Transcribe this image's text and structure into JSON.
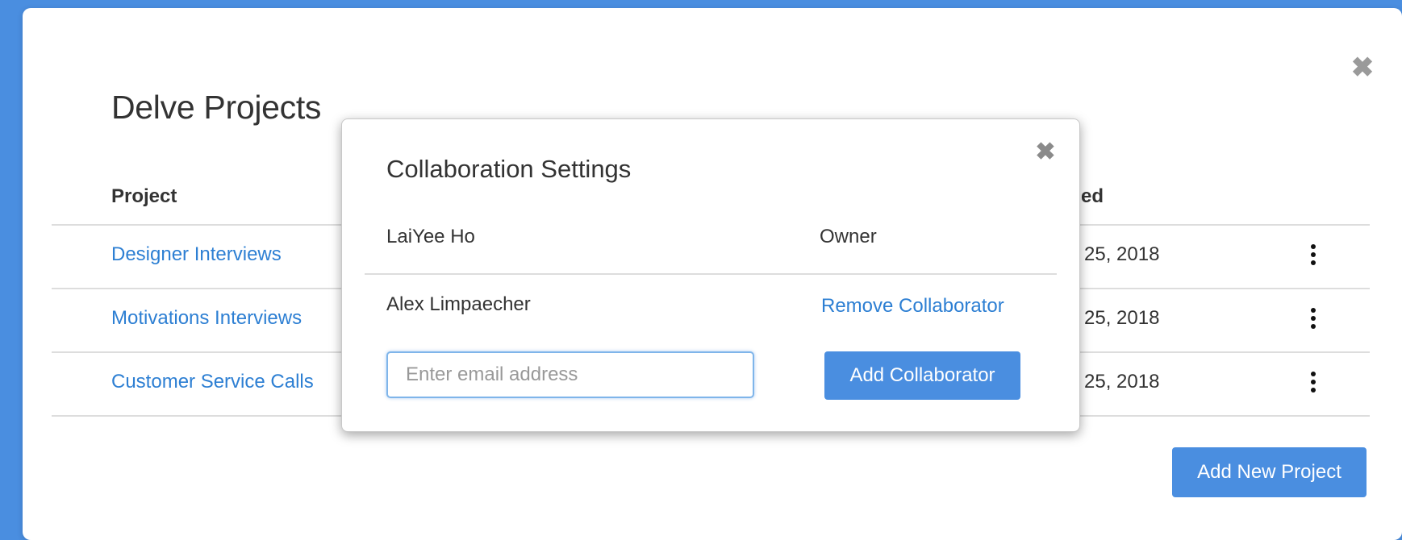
{
  "main_modal": {
    "title": "Delve Projects",
    "close_glyph": "✖",
    "headers": {
      "project": "Project",
      "date_partial": "ed"
    },
    "rows": [
      {
        "project": "Designer Interviews",
        "date_partial": "25, 2018"
      },
      {
        "project": "Motivations Interviews",
        "date_partial": "25, 2018"
      },
      {
        "project": "Customer Service Calls",
        "date_partial": "25, 2018"
      }
    ],
    "add_project_label": "Add New Project"
  },
  "collab_modal": {
    "title": "Collaboration Settings",
    "close_glyph": "✖",
    "collaborators": [
      {
        "name": "LaiYee Ho",
        "role": "Owner"
      },
      {
        "name": "Alex Limpaecher",
        "action": "Remove Collaborator"
      }
    ],
    "email_placeholder": "Enter email address",
    "email_value": "",
    "add_collab_label": "Add Collaborator"
  },
  "colors": {
    "background": "#4a8ee0",
    "accent": "#4a8ee0",
    "link": "#2d7fd3"
  },
  "icons": {
    "main_close": "close-icon",
    "collab_close": "close-icon",
    "row_menu": "kebab-menu-icon"
  }
}
